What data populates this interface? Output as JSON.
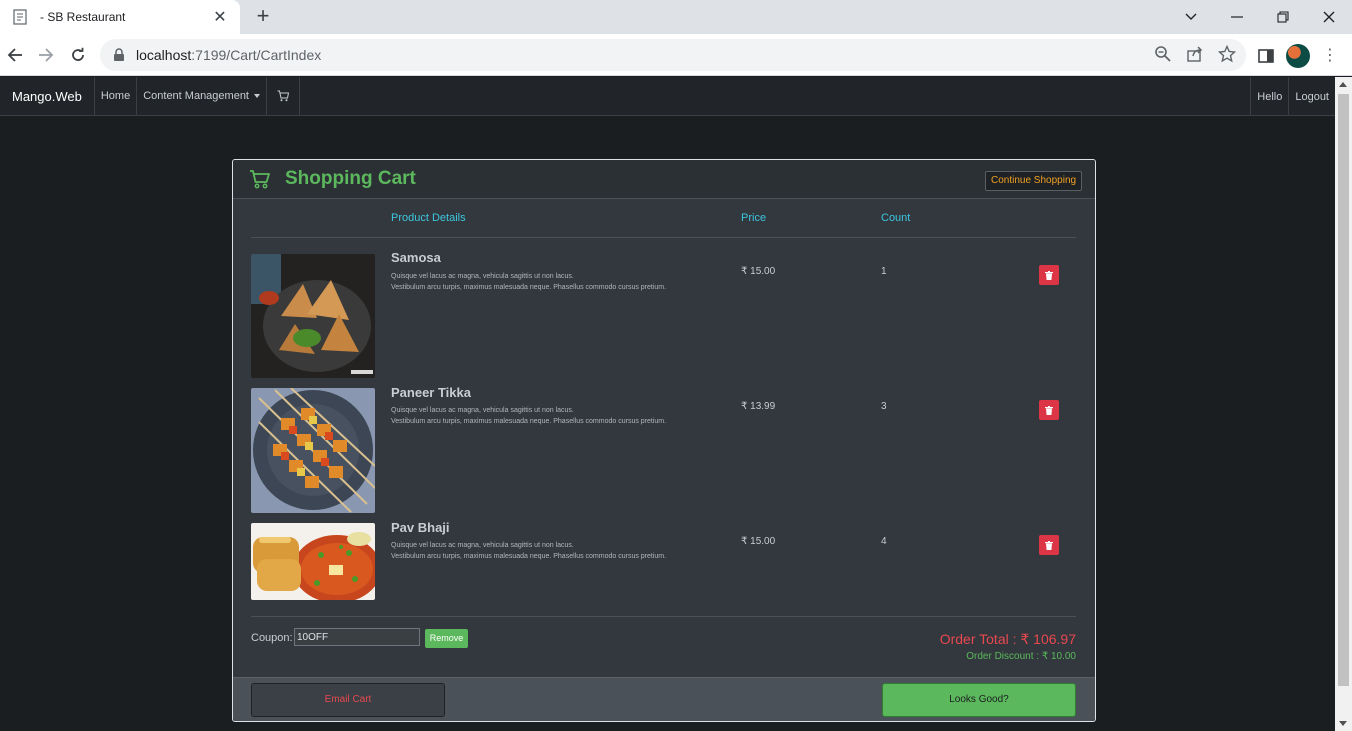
{
  "browser": {
    "tab_title": "- SB Restaurant",
    "tab_close": "✕",
    "new_tab": "+",
    "url_host": "localhost",
    "url_path": ":7199/Cart/CartIndex"
  },
  "appnav": {
    "brand": "Mango.Web",
    "links": [
      "Home",
      "Content Management"
    ],
    "right_links": [
      "Hello",
      "Logout"
    ]
  },
  "cart": {
    "title": "Shopping Cart",
    "continue_label": "Continue Shopping",
    "columns": {
      "product": "Product Details",
      "price": "Price",
      "count": "Count"
    },
    "items": [
      {
        "name": "Samosa",
        "desc_line1": "Quisque vel lacus ac magna, vehicula sagittis ut non lacus.",
        "desc_line2": "Vestibulum arcu turpis, maximus malesuada neque. Phasellus commodo cursus pretium.",
        "price": "₹ 15.00",
        "count": "1",
        "image": "samosa-photo"
      },
      {
        "name": "Paneer Tikka",
        "desc_line1": "Quisque vel lacus ac magna, vehicula sagittis ut non lacus.",
        "desc_line2": "Vestibulum arcu turpis, maximus malesuada neque. Phasellus commodo cursus pretium.",
        "price": "₹ 13.99",
        "count": "3",
        "image": "paneer-tikka-photo"
      },
      {
        "name": "Pav Bhaji",
        "desc_line1": "Quisque vel lacus ac magna, vehicula sagittis ut non lacus.",
        "desc_line2": "Vestibulum arcu turpis, maximus malesuada neque. Phasellus commodo cursus pretium.",
        "price": "₹ 15.00",
        "count": "4",
        "image": "pav-bhaji-photo"
      }
    ],
    "coupon_label": "Coupon:",
    "coupon_value": "10OFF",
    "coupon_button": "Remove",
    "order_total": "Order Total : ₹ 106.97",
    "order_discount": "Order Discount : ₹ 10.00",
    "email_button": "Email Cart",
    "confirm_button": "Looks Good?"
  },
  "colors": {
    "accent_green": "#5cb85c",
    "header_cyan": "#3ec6e0",
    "danger_red": "#dc3545",
    "total_red": "#e8484f",
    "continue_orange": "#f0a020"
  }
}
